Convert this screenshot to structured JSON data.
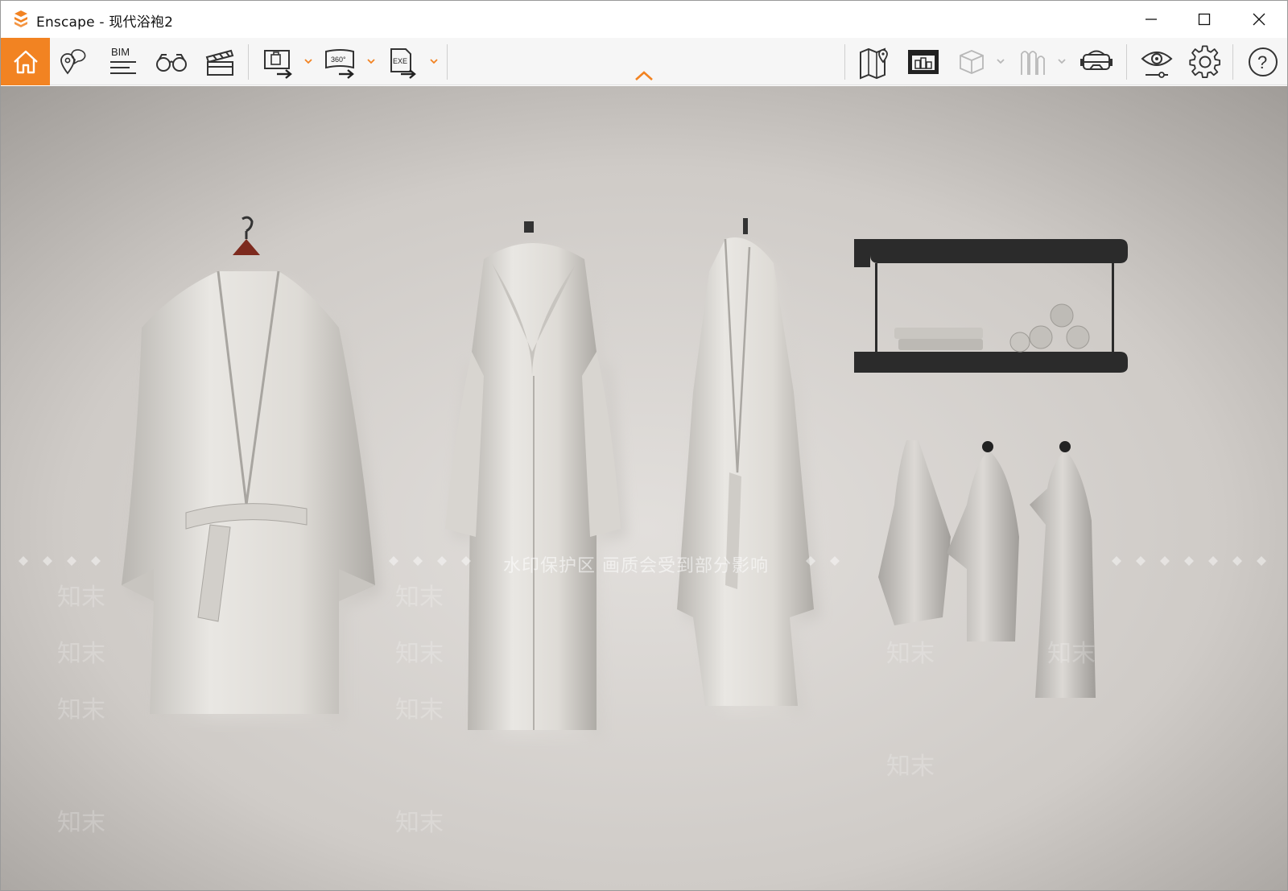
{
  "window": {
    "app_name": "Enscape",
    "title": "Enscape - 现代浴袍2",
    "controls": {
      "minimize_icon": "minimize-icon",
      "maximize_icon": "maximize-icon",
      "close_icon": "close-icon"
    }
  },
  "toolbar": {
    "accent_color": "#f28322",
    "left_tools": [
      {
        "id": "home",
        "icon": "home-icon"
      },
      {
        "id": "views",
        "icon": "map-pin-chat-icon"
      },
      {
        "id": "bim",
        "icon": "bim-icon",
        "label": "BIM"
      },
      {
        "id": "assets",
        "icon": "binoculars-icon"
      },
      {
        "id": "video",
        "icon": "clapperboard-icon"
      }
    ],
    "export_tools": [
      {
        "id": "screenshot",
        "icon": "screenshot-export-icon"
      },
      {
        "id": "panorama",
        "icon": "panorama-export-icon",
        "label": "360°"
      },
      {
        "id": "exe",
        "icon": "exe-export-icon",
        "label": "EXE"
      }
    ],
    "right_tools": [
      {
        "id": "map",
        "icon": "map-icon"
      },
      {
        "id": "web",
        "icon": "web-standalone-icon"
      },
      {
        "id": "cube",
        "icon": "cube-icon"
      },
      {
        "id": "stereo",
        "icon": "stereo-icon"
      },
      {
        "id": "vr",
        "icon": "vr-headset-icon"
      },
      {
        "id": "visual",
        "icon": "eye-icon"
      },
      {
        "id": "settings",
        "icon": "gear-icon"
      },
      {
        "id": "help",
        "icon": "help-icon",
        "label": "?"
      }
    ],
    "collapse_icon": "chevron-up-icon"
  },
  "viewport": {
    "scene": "render-bathrobes-on-wall",
    "watermark_notice": "水印保护区  画质会受到部分影响",
    "watermark_brand": "知末"
  }
}
